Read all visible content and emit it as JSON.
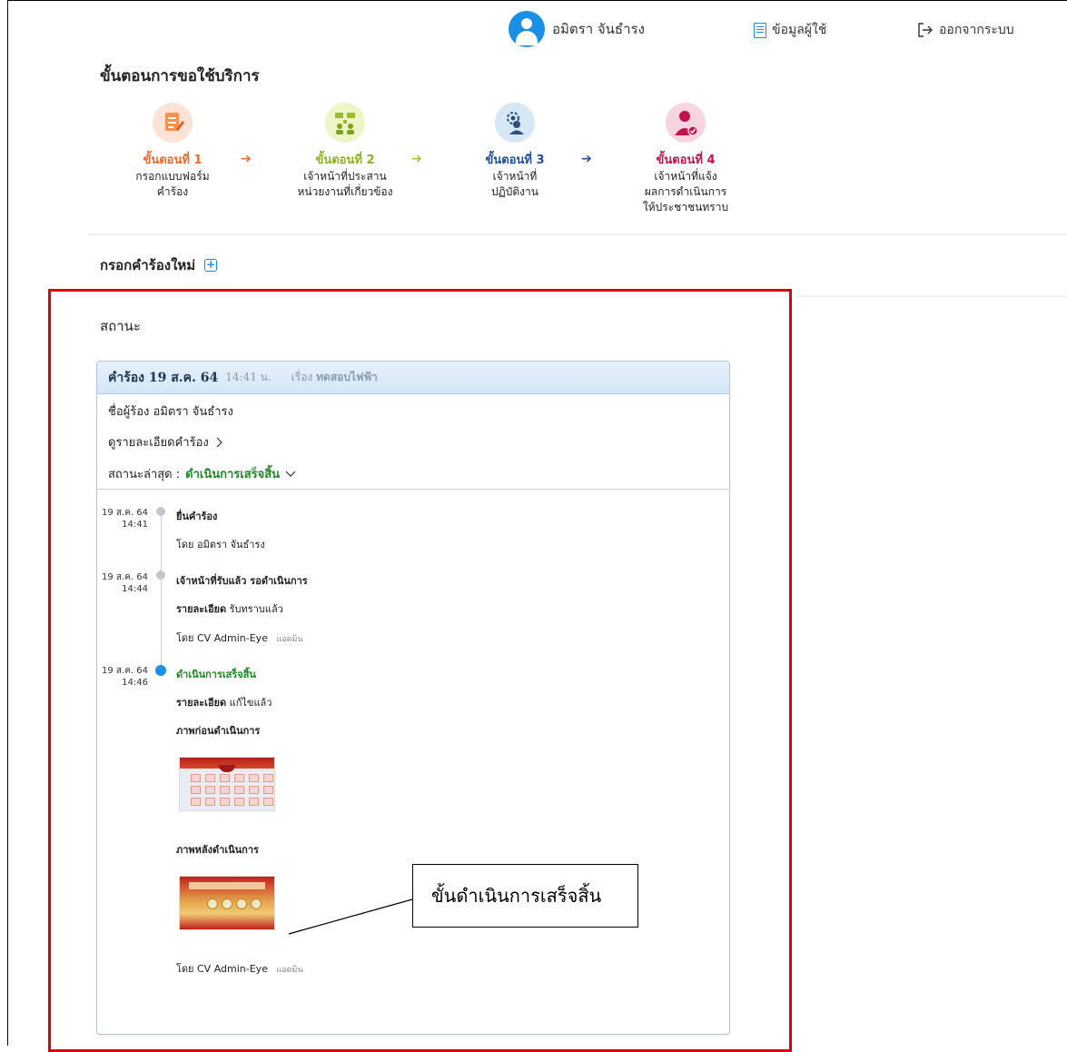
{
  "header": {
    "user_name": "อมิตรา จันธำรง",
    "profile_label": "ข้อมูลผู้ใช้",
    "logout_label": "ออกจากระบบ"
  },
  "page_title": "ขั้นตอนการขอใช้บริการ",
  "steps": [
    {
      "label": "ขั้นตอนที่ 1",
      "desc_line1": "กรอกแบบฟอร์ม",
      "desc_line2": "คำร้อง",
      "desc_line3": "",
      "color": "#f0692d"
    },
    {
      "label": "ขั้นตอนที่ 2",
      "desc_line1": "เจ้าหน้าที่ประสาน",
      "desc_line2": "หน่วยงานที่เกี่ยวข้อง",
      "desc_line3": "",
      "color": "#8cb320"
    },
    {
      "label": "ขั้นตอนที่ 3",
      "desc_line1": "เจ้าหน้าที่",
      "desc_line2": "ปฏิบัติงาน",
      "desc_line3": "",
      "color": "#1e4fa0"
    },
    {
      "label": "ขั้นตอนที่ 4",
      "desc_line1": "เจ้าหน้าที่แจ้ง",
      "desc_line2": "ผลการดำเนินการ",
      "desc_line3": "ให้ประชาชนทราบ",
      "color": "#c4124f"
    }
  ],
  "new_request_label": "กรอกคำร้องใหม่",
  "status_title": "สถานะ",
  "request_card": {
    "request_label": "คำร้อง 19 ส.ค. 64",
    "time": "14:41 น.",
    "subject_prefix": "เรื่อง",
    "subject": "ทดสอบไฟฟ้า",
    "requester_label": "ชื่อผู้ร้อง",
    "requester_name": "อมิตรา จันธำรง",
    "detail_link": "ดูรายละเอียดคำร้อง",
    "latest_label": "สถานะล่าสุด :",
    "latest_value": "ดำเนินการเสร็จสิ้น"
  },
  "timeline": {
    "e1": {
      "date": "19 ส.ค. 64",
      "time": "14:41",
      "title": "ยื่นคำร้อง",
      "by_prefix": "โดย",
      "by_name": "อมิตรา จันธำรง"
    },
    "e2": {
      "date": "19 ส.ค. 64",
      "time": "14:44",
      "title": "เจ้าหน้าที่รับแล้ว รอดำเนินการ",
      "detail_label": "รายละเอียด",
      "detail_value": "รับทราบแล้ว",
      "by_prefix": "โดย",
      "by_name": "CV Admin-Eye",
      "by_role": "แอดมิน"
    },
    "e3": {
      "date": "19 ส.ค. 64",
      "time": "14:46",
      "title": "ดำเนินการเสร็จสิ้น",
      "detail_label": "รายละเอียด",
      "detail_value": "แก้ไขแล้ว",
      "before_label": "ภาพก่อนดำเนินการ",
      "after_label": "ภาพหลังดำเนินการ",
      "by_prefix": "โดย",
      "by_name": "CV Admin-Eye",
      "by_role": "แอดมิน"
    }
  },
  "callout_text": "ขั้นดำเนินการเสร็จสิ้น",
  "colors": {
    "accent": "#1a8fe6",
    "success": "#1d8a22",
    "highlight_border": "#e0000d"
  }
}
